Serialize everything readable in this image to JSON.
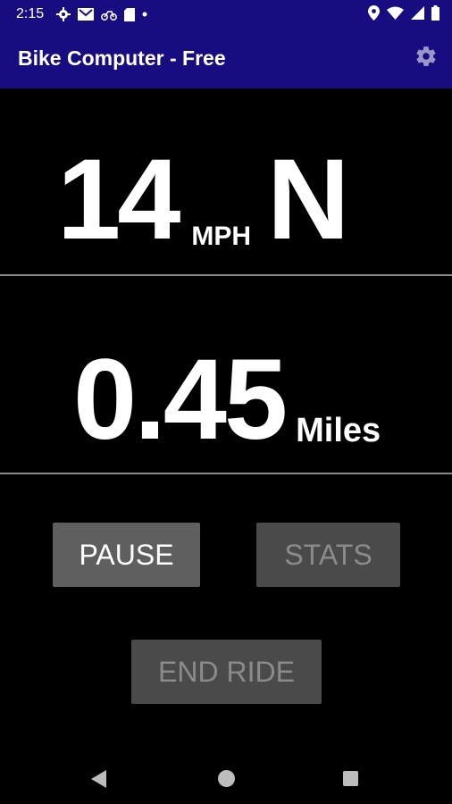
{
  "status_bar": {
    "time": "2:15",
    "left_icons": [
      "gear-icon",
      "gmail-icon",
      "bike-icon",
      "sd-card-icon",
      "dot-icon"
    ],
    "right_icons": [
      "location-icon",
      "wifi-icon",
      "signal-icon",
      "battery-icon"
    ]
  },
  "app_bar": {
    "title": "Bike Computer - Free",
    "settings_icon": "settings-icon",
    "background": "#170c80"
  },
  "speed": {
    "value": "14",
    "unit": "MPH",
    "heading": "N"
  },
  "distance": {
    "value": "0.45",
    "unit": "Miles"
  },
  "buttons": {
    "pause": "PAUSE",
    "stats": "STATS",
    "end_ride": "END RIDE"
  },
  "nav_bar": {
    "icons": [
      "back-icon",
      "home-icon",
      "recents-icon"
    ]
  }
}
